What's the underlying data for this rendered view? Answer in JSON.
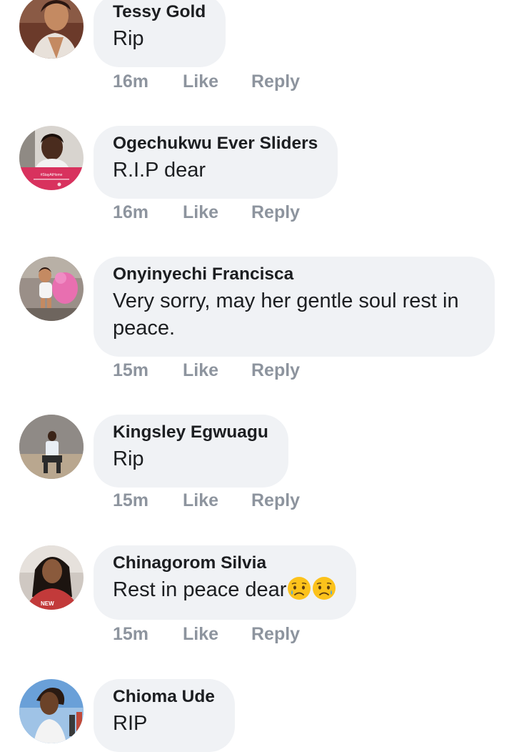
{
  "comments": [
    {
      "author": "Tessy Gold",
      "text": "Rip",
      "time": "16m",
      "like": "Like",
      "reply": "Reply"
    },
    {
      "author": "Ogechukwu Ever Sliders",
      "text": "R.I.P dear",
      "time": "16m",
      "like": "Like",
      "reply": "Reply",
      "avatar_caption": "#StayAtHome"
    },
    {
      "author": "Onyinyechi Francisca",
      "text_line1": "Very sorry, may her gentle soul rest in",
      "text_line2": "peace.",
      "time": "15m",
      "like": "Like",
      "reply": "Reply"
    },
    {
      "author": "Kingsley Egwuagu",
      "text": "Rip",
      "time": "15m",
      "like": "Like",
      "reply": "Reply"
    },
    {
      "author": "Chinagorom Silvia",
      "text": "Rest in peace dear",
      "emojis": [
        "sad-relieved-emoji",
        "sad-relieved-emoji"
      ],
      "time": "15m",
      "like": "Like",
      "reply": "Reply"
    },
    {
      "author": "Chioma Ude",
      "text": "RIP"
    }
  ],
  "colors": {
    "bubble": "#f0f2f5",
    "author": "#1c1e21",
    "meta": "#8d949e"
  }
}
